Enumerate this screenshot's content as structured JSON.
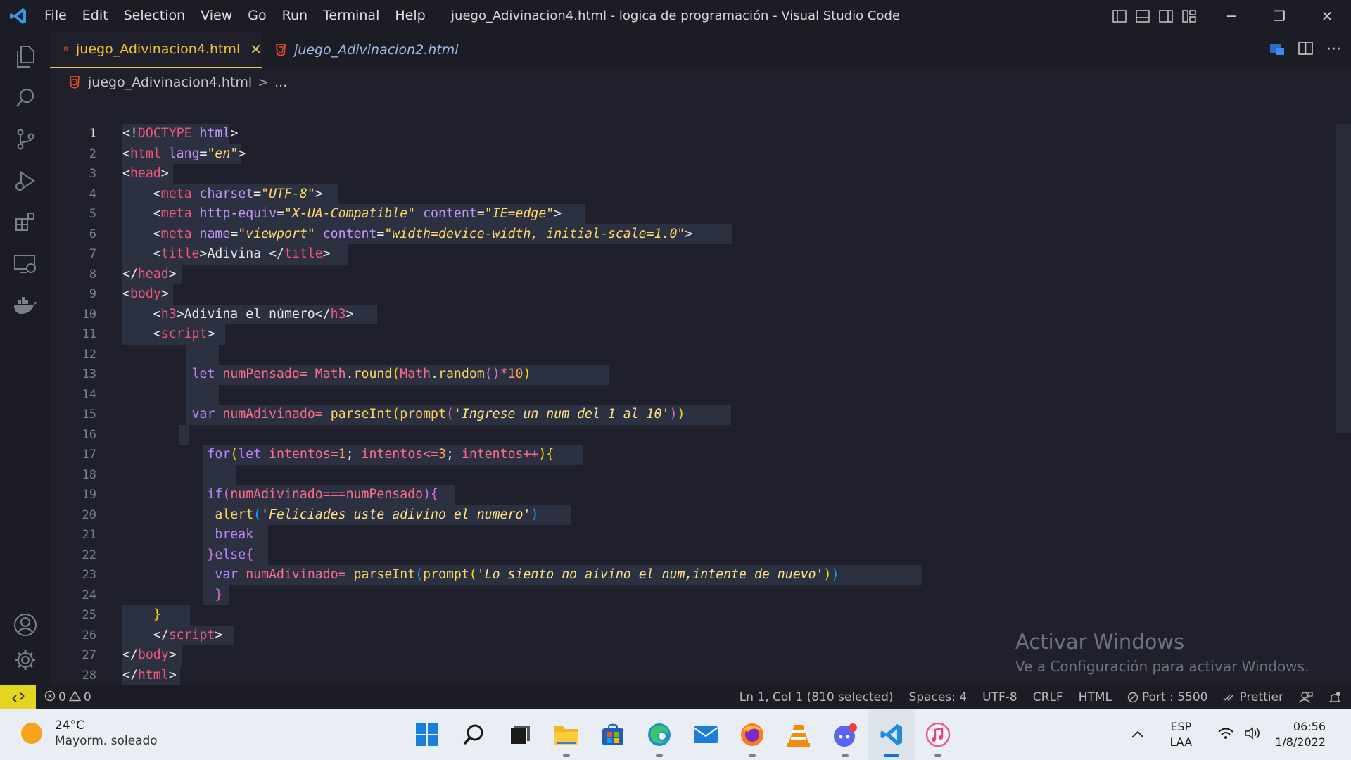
{
  "window": {
    "title": "juego_Adivinacion4.html - logica de programación - Visual Studio Code",
    "menu": [
      "File",
      "Edit",
      "Selection",
      "View",
      "Go",
      "Run",
      "Terminal",
      "Help"
    ],
    "controls": {
      "minimize": "─",
      "restore": "❐",
      "close": "✕"
    }
  },
  "activity_bar": {
    "top": [
      "explorer-icon",
      "search-icon",
      "source-control-icon",
      "run-debug-icon",
      "extensions-icon",
      "remote-explorer-icon",
      "docker-icon"
    ],
    "bottom": [
      "account-icon",
      "settings-gear-icon"
    ]
  },
  "tabs": [
    {
      "label": "juego_Adivinacion4.html",
      "active": true,
      "close": "✕"
    },
    {
      "label": "juego_Adivinacion2.html",
      "active": false
    }
  ],
  "breadcrumb": {
    "file": "juego_Adivinacion4.html",
    "sep": ">",
    "rest": "..."
  },
  "editor": {
    "line_numbers": [
      "1",
      "2",
      "3",
      "4",
      "5",
      "6",
      "7",
      "8",
      "9",
      "10",
      "11",
      "12",
      "13",
      "14",
      "15",
      "16",
      "17",
      "18",
      "19",
      "20",
      "21",
      "22",
      "23",
      "24",
      "25",
      "26",
      "27",
      "28"
    ],
    "tokens": {
      "l1": [
        "<!",
        "DOCTYPE",
        " ",
        "html",
        ">"
      ],
      "l2": [
        "<",
        "html",
        " ",
        "lang",
        "=",
        "\"en\"",
        ">"
      ],
      "l3": [
        "<",
        "head",
        ">"
      ],
      "l4": [
        "    <",
        "meta",
        " ",
        "charset",
        "=",
        "\"UTF-8\"",
        ">"
      ],
      "l5": [
        "    <",
        "meta",
        " ",
        "http-equiv",
        "=",
        "\"X-UA-Compatible\"",
        " ",
        "content",
        "=",
        "\"IE=edge\"",
        ">"
      ],
      "l6": [
        "    <",
        "meta",
        " ",
        "name",
        "=",
        "\"viewport\"",
        " ",
        "content",
        "=",
        "\"width=device-width, initial-scale=1.0\"",
        ">"
      ],
      "l7": [
        "    <",
        "title",
        ">",
        "Adivina ",
        "</",
        "title",
        ">"
      ],
      "l8": [
        "</",
        "head",
        ">"
      ],
      "l9": [
        "<",
        "body",
        ">"
      ],
      "l10": [
        "    <",
        "h3",
        ">",
        "Adivina el número",
        "</",
        "h3",
        ">"
      ],
      "l11": [
        "    <",
        "script",
        ">"
      ],
      "l13": [
        "         ",
        "let",
        " ",
        "numPensado",
        "= ",
        "Math",
        ".",
        "round",
        "(",
        "Math",
        ".",
        "random",
        "()",
        "*",
        "10",
        ")"
      ],
      "l15": [
        "         ",
        "var",
        " ",
        "numAdivinado",
        "= ",
        "parseInt",
        "(",
        "prompt",
        "(",
        "'Ingrese un num del 1 al 10'",
        ")",
        ")"
      ],
      "l17": [
        "           ",
        "for",
        "(",
        "let",
        " ",
        "intentos",
        "=",
        "1",
        "; ",
        "intentos",
        "<=",
        "3",
        "; ",
        "intentos",
        "++",
        ")",
        "{"
      ],
      "l19": [
        "           ",
        "if",
        "(",
        "numAdivinado",
        "===",
        "numPensado",
        ")",
        "{"
      ],
      "l20": [
        "            ",
        "alert",
        "(",
        "'Feliciades uste adivino el numero'",
        ")"
      ],
      "l21": [
        "            ",
        "break"
      ],
      "l22": [
        "           ",
        "}",
        "else",
        "{"
      ],
      "l23": [
        "            ",
        "var",
        " ",
        "numAdivinado",
        "= ",
        "parseInt",
        "(",
        "prompt",
        "(",
        "'Lo siento no aivino el num,intente de nuevo'",
        ")",
        ")"
      ],
      "l24": [
        "            ",
        "}"
      ],
      "l25": [
        "    ",
        "}"
      ],
      "l26": [
        "    </",
        "script",
        ">"
      ],
      "l27": [
        "</",
        "body",
        ">"
      ],
      "l28": [
        "</",
        "html",
        ">"
      ]
    }
  },
  "watermark": {
    "title": "Activar Windows",
    "subtitle": "Ve a Configuración para activar Windows."
  },
  "statusbar": {
    "errors": "0",
    "warnings": "0",
    "position": "Ln 1, Col 1 (810 selected)",
    "spaces": "Spaces: 4",
    "encoding": "UTF-8",
    "eol": "CRLF",
    "language": "HTML",
    "port": "Port : 5500",
    "prettier": "Prettier"
  },
  "taskbar": {
    "weather_temp": "24°C",
    "weather_desc": "Mayorm. soleado",
    "apps": [
      "windows-start-icon",
      "search-icon",
      "task-view-icon",
      "file-explorer-icon",
      "microsoft-store-icon",
      "edge-icon",
      "mail-icon",
      "firefox-icon",
      "vlc-icon",
      "discord-icon",
      "vscode-icon",
      "itunes-icon"
    ],
    "lang_top": "ESP",
    "lang_bottom": "LAA",
    "time": "06:56",
    "date": "1/8/2022"
  }
}
